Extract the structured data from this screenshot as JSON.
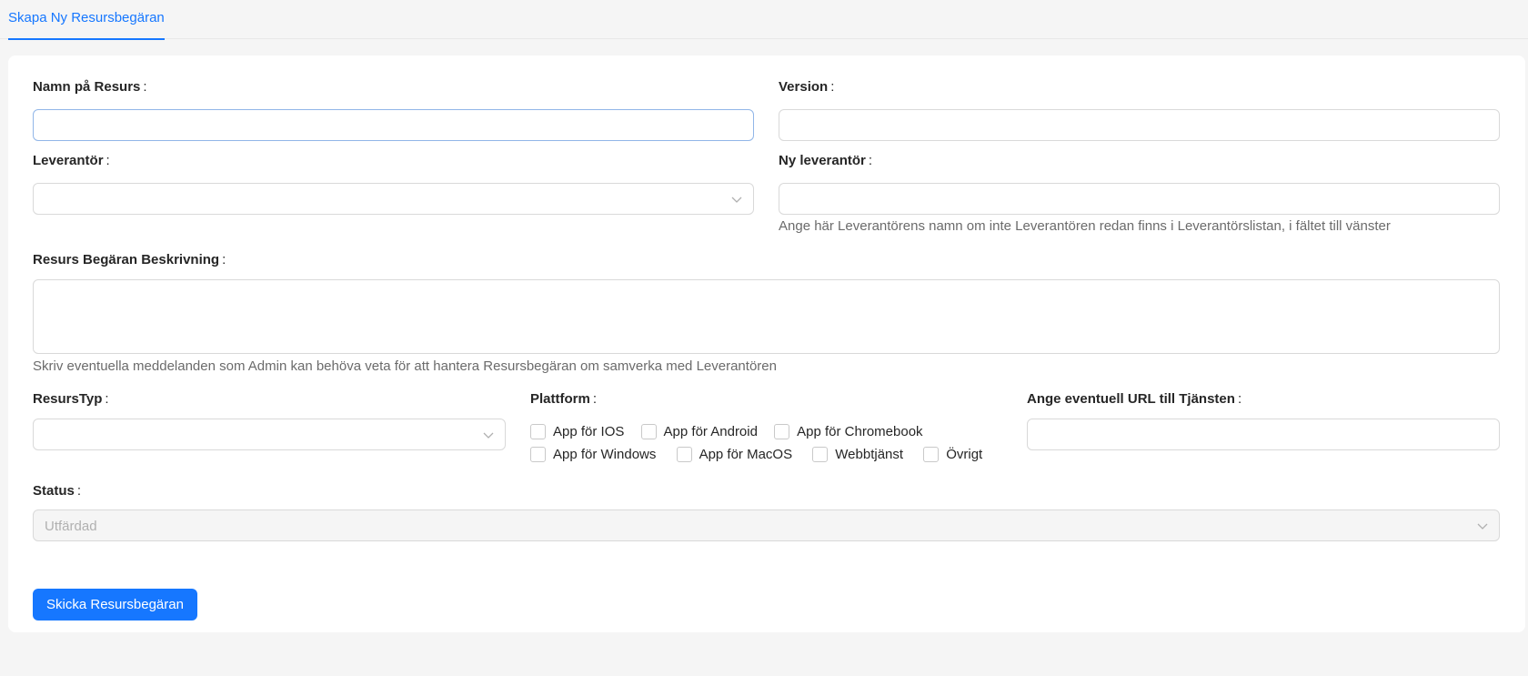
{
  "tabs": [
    {
      "label": "Skapa Ny Resursbegäran"
    }
  ],
  "form": {
    "resource_name": {
      "label": "Namn på Resurs",
      "value": ""
    },
    "version": {
      "label": "Version",
      "value": ""
    },
    "supplier": {
      "label": "Leverantör",
      "value": ""
    },
    "new_supplier": {
      "label": "Ny leverantör",
      "value": "",
      "help": "Ange här Leverantörens namn om inte Leverantören redan finns i Leverantörslistan, i fältet till vänster"
    },
    "description": {
      "label": "Resurs Begäran Beskrivning",
      "value": "",
      "help": "Skriv eventuella meddelanden som Admin kan behöva veta för att hantera Resursbegäran om samverka med Leverantören"
    },
    "resource_type": {
      "label": "ResursTyp",
      "value": ""
    },
    "platform": {
      "label": "Plattform",
      "options": [
        "App för IOS",
        "App för Android",
        "App för Chromebook",
        "App för Windows",
        "App för MacOS",
        "Webbtjänst",
        "Övrigt"
      ]
    },
    "url": {
      "label": "Ange eventuell URL till Tjänsten",
      "value": ""
    },
    "status": {
      "label": "Status",
      "value": "Utfärdad"
    },
    "colon": ":",
    "submit_label": "Skicka Resursbegäran"
  },
  "colors": {
    "accent": "#1677ff",
    "border": "#d9d9d9",
    "background": "#f5f5f5"
  },
  "icons": {
    "select": "chevron-down-icon"
  }
}
